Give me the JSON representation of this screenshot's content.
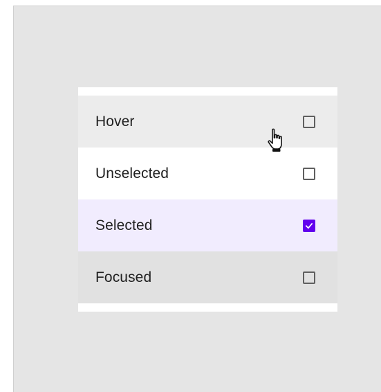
{
  "list": {
    "items": [
      {
        "label": "Hover",
        "state": "hover",
        "checked": false
      },
      {
        "label": "Unselected",
        "state": "unselected",
        "checked": false
      },
      {
        "label": "Selected",
        "state": "selected",
        "checked": true
      },
      {
        "label": "Focused",
        "state": "focused",
        "checked": false
      }
    ]
  },
  "colors": {
    "canvas_background": "#e5e5e5",
    "hover_background": "#ececec",
    "selected_background": "#f1ecfe",
    "focused_background": "#e1e1e1",
    "accent": "#6200ee",
    "checkbox_border": "#5f5f5f"
  },
  "icons": {
    "checkbox_unchecked": "checkbox-unchecked-icon",
    "checkbox_checked": "checkbox-checked-icon",
    "cursor": "hand-pointer-cursor-icon"
  }
}
